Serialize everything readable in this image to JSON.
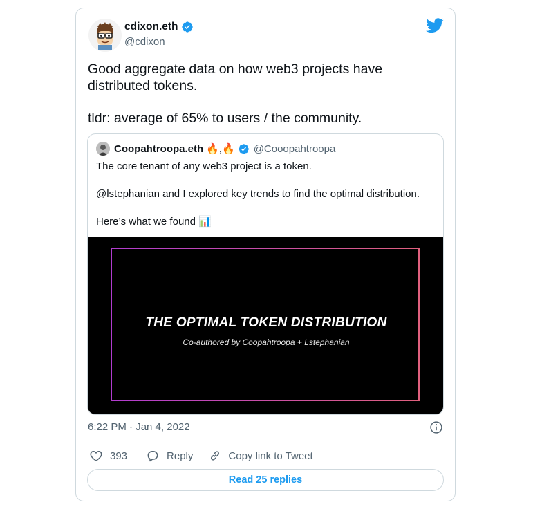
{
  "author": {
    "name": "cdixon.eth",
    "handle": "@cdixon"
  },
  "tweet": {
    "line1": "Good aggregate data on how web3 projects have",
    "line2": "distributed tokens.",
    "line3": "tldr: average of 65% to users / the community."
  },
  "quote": {
    "name": "Coopahtroopa.eth",
    "name_emoji": "🔥,🔥",
    "handle": "@Cooopahtroopa",
    "p1": "The core tenant of any web3 project is a token.",
    "p2": "@lstephanian and I explored key trends to find the optimal distribution.",
    "p3": "Here’s what we found 📊",
    "media": {
      "title": "THE OPTIMAL TOKEN DISTRIBUTION",
      "subtitle": "Co-authored by Coopahtroopa + Lstephanian"
    }
  },
  "meta": {
    "timestamp": "6:22 PM · Jan 4, 2022"
  },
  "actions": {
    "likes": "393",
    "reply_label": "Reply",
    "copy_label": "Copy link to Tweet"
  },
  "replies_button": "Read 25 replies",
  "colors": {
    "accent": "#1d9bf0",
    "text": "#0f1419",
    "muted": "#536471",
    "border": "#cfd9de"
  },
  "icons": [
    "avatar-cartoon",
    "verified-badge-icon",
    "twitter-bird-icon",
    "info-icon",
    "heart-icon",
    "reply-bubble-icon",
    "link-icon"
  ]
}
